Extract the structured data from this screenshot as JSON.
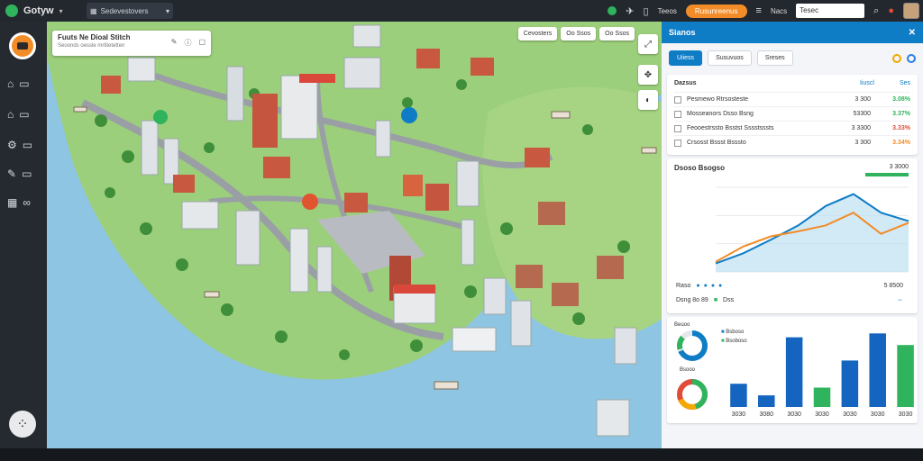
{
  "topbar": {
    "brand": "Gotyw",
    "search_value": "Sedevestovers",
    "label_right": "Teeos",
    "orange_pill": "Rusunreenus",
    "label_mid": "Nacs",
    "input_value": "Tesec",
    "icons": [
      "status-dot-icon",
      "pin-icon",
      "doc-icon",
      "search-icon",
      "alert-icon"
    ]
  },
  "sidebar": {
    "items": [
      {
        "icon": "users-icon"
      },
      {
        "icon": "house-icon"
      },
      {
        "icon": "settings-icon"
      },
      {
        "icon": "chat-icon"
      },
      {
        "icon": "grid-icon"
      }
    ]
  },
  "map": {
    "card": {
      "title": "Fuuts Ne Dioal Stitch",
      "sub": "Seoonds oessle mrtitetetten"
    },
    "filters": [
      "Cevosters",
      "Oo Ssos",
      "Oo Ssos"
    ],
    "tools": [
      "expand-icon",
      "move-icon",
      "compass-icon"
    ]
  },
  "panel": {
    "title": "Sianos",
    "tabs": [
      "Uiiess",
      "Susuvuos",
      "Sreses"
    ],
    "stats": {
      "title": "Dazsus",
      "col1": "Iiuscl",
      "col2": "Ses",
      "rows": [
        {
          "label": "Pesmewo Rtrsosteste",
          "v1": "3 300",
          "v2": "3.08%",
          "color": "#2fb35c"
        },
        {
          "label": "Mosseanors Dsso Bsng",
          "v1": "53300",
          "v2": "3.37%",
          "color": "#2fb35c"
        },
        {
          "label": "Feooestrssto Bsstst Sssstsssts",
          "v1": "3 3300",
          "v2": "3.33%",
          "color": "#e04b3a"
        },
        {
          "label": "Crsosst Bssst Bsssto",
          "v1": "3 300",
          "v2": "3.34%",
          "color": "#f28c28"
        }
      ]
    },
    "trend": {
      "title": "Dsoso Bsogso",
      "value": "3 3000",
      "footer_label": "Raso",
      "footer_value": "5 8500",
      "legend1": "Dsng 8o 89",
      "legend2": "Dss"
    },
    "bars": {
      "donut1_label": "Beuoo",
      "donut2_label": "Bsooo",
      "legend_a": "Bsboso",
      "legend_b": "Bsoboso",
      "x_labels": [
        "3030",
        "3080",
        "3030",
        "3030",
        "3030",
        "3030",
        "3030"
      ]
    }
  },
  "chart_data": [
    {
      "type": "line",
      "title": "Dsoso Bsogso",
      "series": [
        {
          "name": "",
          "color": "#0f7cc6",
          "values": [
            10,
            22,
            38,
            55,
            78,
            92,
            70,
            60
          ]
        },
        {
          "name": "",
          "color": "#f28c28",
          "values": [
            12,
            30,
            42,
            48,
            55,
            70,
            45,
            58
          ]
        }
      ]
    },
    {
      "type": "bar",
      "values": [
        30,
        15,
        90,
        25,
        60,
        95,
        80
      ],
      "colors": [
        "#1565c0",
        "#1565c0",
        "#1565c0",
        "#2fb35c",
        "#1565c0",
        "#1565c0",
        "#2fb35c"
      ]
    }
  ]
}
